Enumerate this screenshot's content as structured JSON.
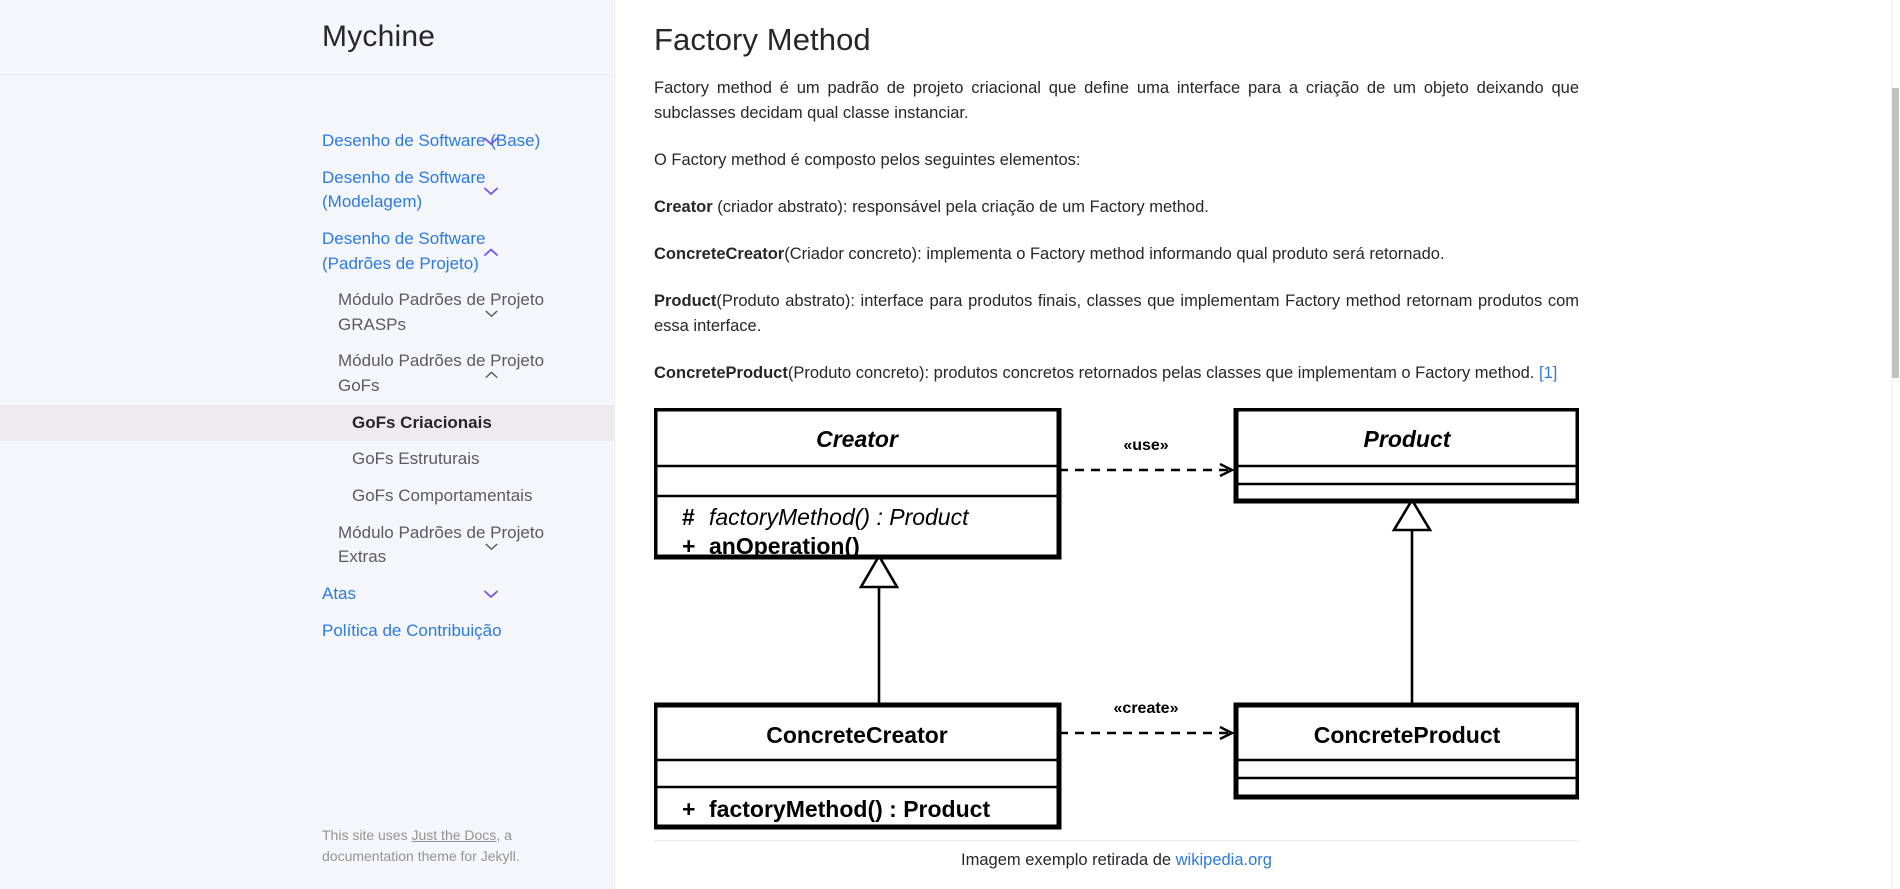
{
  "sidebar": {
    "site_title": "Mychine",
    "nav": [
      {
        "label": "Desenho de Software (Base)",
        "level": 1,
        "chevron": "chevron-down",
        "chevron_color": "#7253ed",
        "active": false
      },
      {
        "label": "Desenho de Software (Modelagem)",
        "level": 1,
        "chevron": "chevron-down",
        "chevron_color": "#7253ed",
        "active": false
      },
      {
        "label": "Desenho de Software (Padrões de Projeto)",
        "level": 1,
        "chevron": "chevron-up",
        "chevron_color": "#7253ed",
        "active": false
      },
      {
        "label": "Módulo Padrões de Projeto GRASPs",
        "level": 2,
        "chevron": "chevron-down",
        "chevron_color": "#5c5962",
        "active": false
      },
      {
        "label": "Módulo Padrões de Projeto GoFs",
        "level": 2,
        "chevron": "chevron-up",
        "chevron_color": "#5c5962",
        "active": false
      },
      {
        "label": "GoFs Criacionais",
        "level": 3,
        "chevron": null,
        "active": true
      },
      {
        "label": "GoFs Estruturais",
        "level": 3,
        "chevron": null,
        "active": false
      },
      {
        "label": "GoFs Comportamentais",
        "level": 3,
        "chevron": null,
        "active": false
      },
      {
        "label": "Módulo Padrões de Projeto Extras",
        "level": 2,
        "chevron": "chevron-down",
        "chevron_color": "#5c5962",
        "active": false
      },
      {
        "label": "Atas",
        "level": 1,
        "chevron": "chevron-down",
        "chevron_color": "#7253ed",
        "active": false
      },
      {
        "label": "Política de Contribuição",
        "level": 1,
        "chevron": null,
        "active": false
      }
    ],
    "footer": {
      "prefix": "This site uses ",
      "link": "Just the Docs",
      "suffix": ", a documentation theme for Jekyll."
    }
  },
  "main": {
    "title": "Factory Method",
    "paragraphs": [
      {
        "plain": "Factory method é um padrão de projeto criacional que define uma interface para a criação de um objeto deixando que subclasses decidam qual classe instanciar."
      },
      {
        "plain": "O Factory method é composto pelos seguintes elementos:"
      },
      {
        "bold": "Creator",
        "plain": " (criador abstrato): responsável pela criação de um Factory method."
      },
      {
        "bold": "ConcreteCreator",
        "plain": "(Criador concreto): implementa o Factory method informando qual produto será retornado."
      },
      {
        "bold": "Product",
        "plain": "(Produto abstrato): interface para produtos finais, classes que implementam Factory method retornam produtos com essa interface."
      },
      {
        "bold": "ConcreteProduct",
        "plain": "(Produto concreto): produtos concretos retornados pelas classes que implementam o Factory method. ",
        "ref": "[1]"
      }
    ],
    "figure": {
      "caption_prefix": "Imagem exemplo retirada de ",
      "caption_link": "wikipedia.org",
      "classes": [
        {
          "id": "creator",
          "name": "Creator",
          "abstract": true,
          "attributes": [],
          "operations": [
            "# factoryMethod() : Product",
            "+ anOperation()"
          ]
        },
        {
          "id": "product",
          "name": "Product",
          "abstract": true,
          "attributes": [],
          "operations": []
        },
        {
          "id": "concrete-creator",
          "name": "ConcreteCreator",
          "abstract": false,
          "attributes": [],
          "operations": [
            "+ factoryMethod() : Product"
          ]
        },
        {
          "id": "concrete-product",
          "name": "ConcreteProduct",
          "abstract": false,
          "attributes": [],
          "operations": []
        }
      ],
      "relations": [
        {
          "from": "creator",
          "to": "product",
          "type": "dependency",
          "stereotype": "«use»"
        },
        {
          "from": "concrete-creator",
          "to": "concrete-product",
          "type": "dependency",
          "stereotype": "«create»"
        },
        {
          "from": "concrete-creator",
          "to": "creator",
          "type": "generalization",
          "stereotype": ""
        },
        {
          "from": "concrete-product",
          "to": "product",
          "type": "generalization",
          "stereotype": ""
        }
      ],
      "labels": {
        "creator_title": "Creator",
        "creator_op1": "factoryMethod() : Product",
        "creator_op1_vis": "#",
        "creator_op2": "anOperation()",
        "creator_op2_vis": "+",
        "product_title": "Product",
        "concrete_creator_title": "ConcreteCreator",
        "concrete_creator_op1": "factoryMethod() : Product",
        "concrete_creator_op1_vis": "+",
        "concrete_product_title": "ConcreteProduct",
        "use_label": "«use»",
        "create_label": "«create»"
      }
    }
  },
  "colors": {
    "link": "#2a7ae2",
    "sidebar_bg": "#f5f6fa",
    "accent_chevron": "#7253ed",
    "text": "#27262b",
    "muted": "#959396"
  }
}
